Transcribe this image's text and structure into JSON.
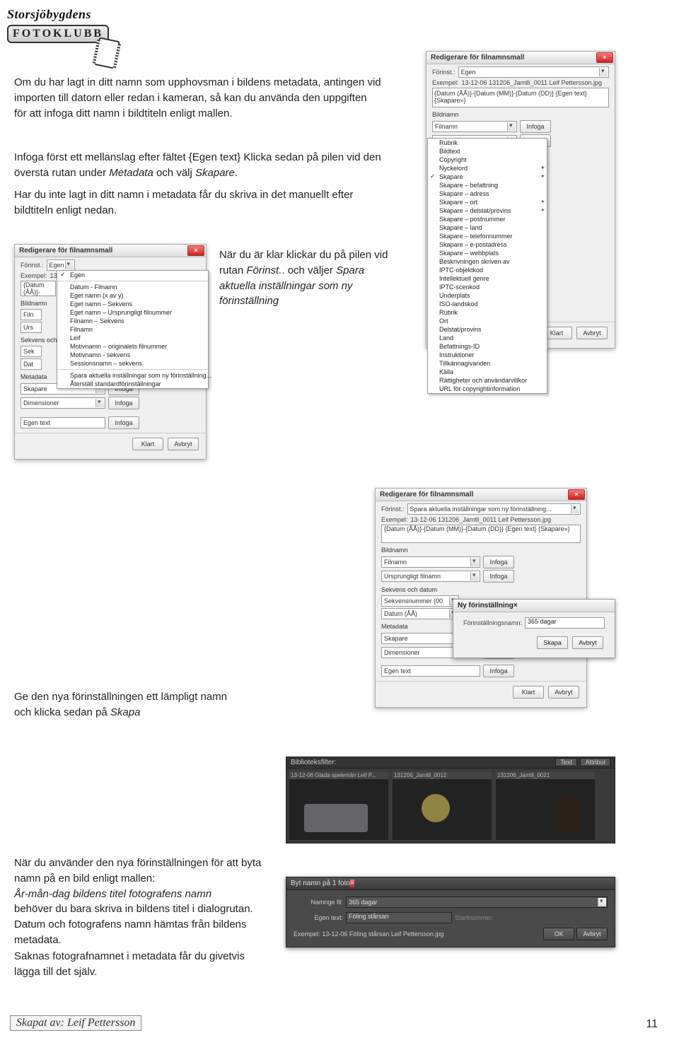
{
  "logo": {
    "top": "Storsjöbygdens",
    "bottom": "FOTOKLUBB"
  },
  "paragraphs": {
    "p1": "Om du har lagt in ditt namn som upphovsman i bildens metadata, antingen vid importen till datorn eller redan i kameran, så kan du använda den uppgiften för att infoga ditt namn i bildtiteln enligt mallen.",
    "p2a": "Infoga först ett mellanslag efter fältet {Egen text} Klicka sedan på pilen vid den översta rutan under ",
    "p2b": "Metadata",
    "p2c": " och välj ",
    "p2d": "Skapare",
    "p2e": ".",
    "p3": "Har du inte lagt in ditt namn i metadata får du skriva in det manuellt efter bildtiteln enligt nedan.",
    "p4a": "När du är klar klickar du på pilen vid rutan ",
    "p4b": "Förinst.",
    "p4c": ". och väljer ",
    "p4d": "Spara aktuella inställningar som ny förinställning",
    "p5a": "Ge den nya förinställningen ett lämpligt namn och klicka sedan på ",
    "p5b": "Skapa",
    "p6a": "När du använder den nya förinställningen för att byta namn på en bild enligt mallen: ",
    "p6b": "År-mån-dag bildens titel fotografens namn",
    "p6c": " behöver du bara skriva in bildens titel i dialogrutan. Datum och fotografens namn hämtas från bildens metadata.",
    "p7": "Saknas fotografnamnet i metadata får du givetvis lägga till det själv."
  },
  "dlg_right": {
    "title": "Redigerare för filnamnsmall",
    "forinst_lbl": "Förinst.:",
    "forinst_val": "Egen",
    "exempel_lbl": "Exempel:",
    "exempel_val": "13-12-06 131206_Jamtli_0011 Leif Pettersson.jpg",
    "pattern": "{Datum (ÅÅ)}-{Datum (MM)}-{Datum (DD)} {Egen text} {Skapare»}",
    "bildnamn": "Bildnamn",
    "filnamn": "Filnamn",
    "infoga": "Infoga",
    "klart": "Klart",
    "avbryt": "Avbryt",
    "meta": {
      "items": [
        {
          "t": "Rubrik",
          "a": false
        },
        {
          "t": "Bildtext",
          "a": false
        },
        {
          "t": "Copyright",
          "a": false
        },
        {
          "t": "Nyckelord",
          "a": true
        },
        {
          "t": "Skapare",
          "a": true,
          "chk": true
        },
        {
          "t": "Skapare – befattning",
          "a": false
        },
        {
          "t": "Skapare – adress",
          "a": false
        },
        {
          "t": "Skapare – ort",
          "a": true
        },
        {
          "t": "Skapare – delstat/provins",
          "a": true
        },
        {
          "t": "Skapare – postnummer",
          "a": false
        },
        {
          "t": "Skapare – land",
          "a": false
        },
        {
          "t": "Skapare – telefonnummer",
          "a": false
        },
        {
          "t": "Skapare – e-postadress",
          "a": false
        },
        {
          "t": "Skapare – webbplats",
          "a": false
        },
        {
          "t": "Beskrivningen skriven av",
          "a": false
        },
        {
          "t": "IPTC-objektkod",
          "a": false
        },
        {
          "t": "Intellektuell genre",
          "a": false
        },
        {
          "t": "IPTC-scenkod",
          "a": false
        },
        {
          "t": "Underplats",
          "a": false
        },
        {
          "t": "ISO-landskod",
          "a": false
        },
        {
          "t": "Rubrik",
          "a": false
        },
        {
          "t": "Ort",
          "a": false
        },
        {
          "t": "Delstat/provins",
          "a": false
        },
        {
          "t": "Land",
          "a": false
        },
        {
          "t": "Befattnings-ID",
          "a": false
        },
        {
          "t": "Instruktioner",
          "a": false
        },
        {
          "t": "Tillkännagivanden",
          "a": false
        },
        {
          "t": "Källa",
          "a": false
        },
        {
          "t": "Rättigheter och användarvillkor",
          "a": false
        },
        {
          "t": "URL för copyrightinformation",
          "a": false
        }
      ]
    }
  },
  "dlg_left": {
    "title": "Redigerare för filnamnsmall",
    "forinst_lbl": "Förinst.:",
    "forinst_val": "Egen",
    "exempel_lbl": "Exempel:",
    "exempel_val": "13-12",
    "pattern": "{Datum (ÅÅ)}-",
    "bildnamn": "Bildnamn",
    "row_filn": "Filn",
    "row_urs": "Urs",
    "sekv": "Sekvens och datum",
    "row_sek": "Sek",
    "row_dat": "Dat",
    "metadata": "Metadata",
    "skapare": "Skapare",
    "dimensioner": "Dimensioner",
    "egen_text": "Egen text",
    "infoga": "Infoga",
    "klart": "Klart",
    "avbryt": "Avbryt",
    "menu": {
      "items": [
        {
          "t": "Egen",
          "chk": true
        },
        {
          "sep": true
        },
        {
          "t": "Datum - Filnamn"
        },
        {
          "t": "Eget namn (x av y)"
        },
        {
          "t": "Eget namn – Sekvens"
        },
        {
          "t": "Eget namn – Ursprungligt filnummer"
        },
        {
          "t": "Filnamn – Sekvens"
        },
        {
          "t": "Filnamn"
        },
        {
          "t": "Leif"
        },
        {
          "t": "Motivnamn – originalets filnummer"
        },
        {
          "t": "Motivnamn - sekvens"
        },
        {
          "t": "Sessionsnamn – sekvens"
        },
        {
          "sep": true
        },
        {
          "t": "Spara aktuella inställningar som ny förinställning..."
        },
        {
          "t": "Återställ standardförinställningar"
        }
      ]
    }
  },
  "dlg_mid": {
    "title": "Redigerare för filnamnsmall",
    "forinst_lbl": "Förinst.:",
    "forinst_val": "Spara aktuella inställningar som ny förinställning...",
    "exempel_lbl": "Exempel:",
    "exempel_val": "13-12-06 131206_Jamtli_0011 Leif Pettersson.jpg",
    "pattern": "{Datum (ÅÅ)}-{Datum (MM)}-{Datum (DD)} {Egen text} {Skapare»}",
    "bildnamn": "Bildnamn",
    "filnamn": "Filnamn",
    "ursprung": "Ursprungligt filnamn",
    "sekv": "Sekvens och datum",
    "sekvnum": "Sekvensnummer (00",
    "datum": "Datum (ÅÅ)",
    "metadata": "Metadata",
    "skapare": "Skapare",
    "dimensioner": "Dimensioner",
    "egen_text": "Egen text",
    "infoga": "Infoga",
    "klart": "Klart",
    "avbryt": "Avbryt"
  },
  "new_preset": {
    "title": "Ny förinställning",
    "lbl": "Förinställningsnamn:",
    "val": "365 dagar",
    "skapa": "Skapa",
    "avbryt": "Avbryt"
  },
  "strip": {
    "title": "Biblioteksfilter:",
    "text_tab": "Text",
    "attr_tab": "Attribut",
    "thumbs": [
      {
        "cap": "13-12-06 Glada spelemän Leif P..."
      },
      {
        "cap": "131206_Jamtli_0012"
      },
      {
        "cap": "131206_Jamtli_0021"
      }
    ]
  },
  "rename": {
    "title": "Byt namn på 1 foto",
    "namnge_lbl": "Namnge fil:",
    "namnge_val": "365 dagar",
    "egen_lbl": "Egen text:",
    "egen_val": "Föling stårsan",
    "start_lbl": "Startnummer:",
    "exempel_lbl": "Exempel:",
    "exempel_val": "13-12-06 Föling stårsan Leif Pettersson.jpg",
    "ok": "OK",
    "avbryt": "Avbryt"
  },
  "page": {
    "num": "11",
    "credit": "Skapat av: Leif Pettersson"
  }
}
